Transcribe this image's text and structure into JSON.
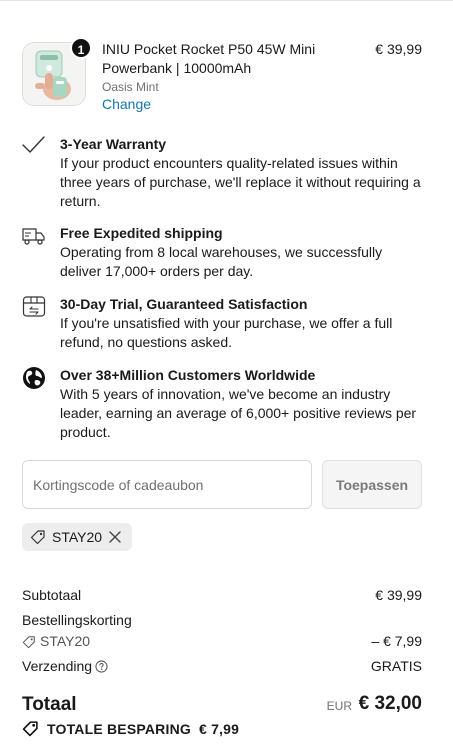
{
  "product": {
    "quantity": "1",
    "title": "INIU Pocket Rocket P50 45W Mini Powerbank | 10000mAh",
    "variant": "Oasis Mint",
    "change_label": "Change",
    "price": "€ 39,99",
    "image_icon": "powerbank-product-image"
  },
  "features": [
    {
      "icon": "checkmark-icon",
      "title": "3-Year Warranty",
      "body": "If your product encounters quality-related issues within three years of purchase, we'll replace it without requiring a return."
    },
    {
      "icon": "delivery-truck-icon",
      "title": "Free Expedited shipping",
      "body": "Operating from 8 local warehouses, we successfully deliver 17,000+ orders per day."
    },
    {
      "icon": "box-return-icon",
      "title": "30-Day Trial, Guaranteed Satisfaction",
      "body": "If you're unsatisfied with your purchase, we offer a full refund, no questions asked."
    },
    {
      "icon": "globe-icon",
      "title": "Over 38+Million Customers Worldwide",
      "body": "With 5 years of innovation, we've become an industry leader, earning an average of 6,000+ positive reviews per product."
    }
  ],
  "discount": {
    "placeholder": "Kortingscode of cadeaubon",
    "apply_label": "Toepassen",
    "applied_code": "STAY20"
  },
  "totals": {
    "subtotal_label": "Subtotaal",
    "subtotal_value": "€ 39,99",
    "order_discount_label": "Bestellingskorting",
    "order_discount_code": "STAY20",
    "order_discount_value": "– € 7,99",
    "shipping_label": "Verzending",
    "shipping_value": "GRATIS",
    "total_label": "Totaal",
    "currency": "EUR",
    "total_value": "€ 32,00",
    "savings_label": "TOTALE BESPARING",
    "savings_value": "€ 7,99"
  },
  "colors": {
    "link": "#1773b0",
    "badge": "#111111",
    "product_mint": "#b9e3d2"
  }
}
